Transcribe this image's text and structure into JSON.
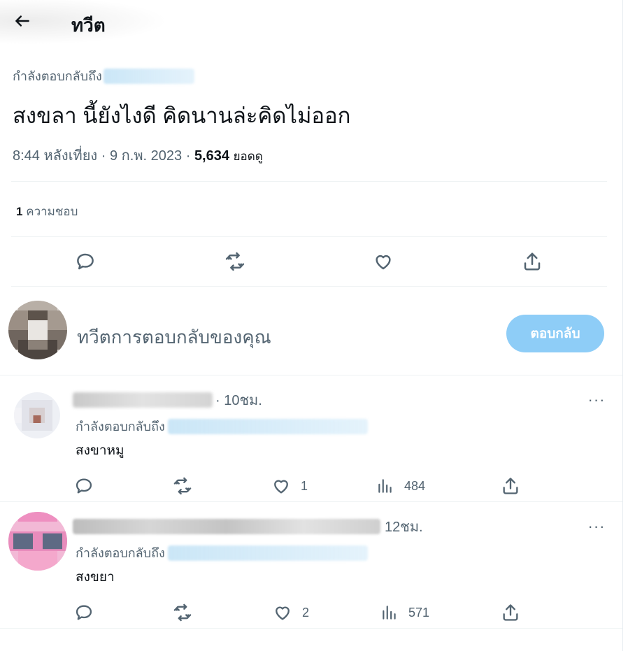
{
  "header": {
    "title": "ทวีต",
    "back_icon": "arrow-left-icon"
  },
  "tweet": {
    "replying_label": "กำลังตอบกลับถึง",
    "text": "สงขลา นี้ยังไงดี คิดนานล่ะคิดไม่ออก",
    "time": "8:44 หลังเที่ยง",
    "date": "9 ก.พ. 2023",
    "views": "5,634",
    "views_label": "ยอดดู",
    "likes_count": "1",
    "likes_label": "ความชอบ",
    "separator": "·"
  },
  "compose": {
    "placeholder": "ทวีตการตอบกลับของคุณ",
    "reply_button": "ตอบกลับ"
  },
  "replies": [
    {
      "time": "· 10ชม.",
      "replying_label": "กำลังตอบกลับถึง",
      "text": "สงขาหมู",
      "likes": "1",
      "views": "484"
    },
    {
      "time": "12ชม.",
      "replying_label": "กำลังตอบกลับถึง",
      "text": "สงขยา",
      "likes": "2",
      "views": "571"
    }
  ],
  "colors": {
    "accent_disabled": "#8ecdf7",
    "secondary_text": "#536471",
    "primary_text": "#0f1419"
  },
  "more_label": "···"
}
